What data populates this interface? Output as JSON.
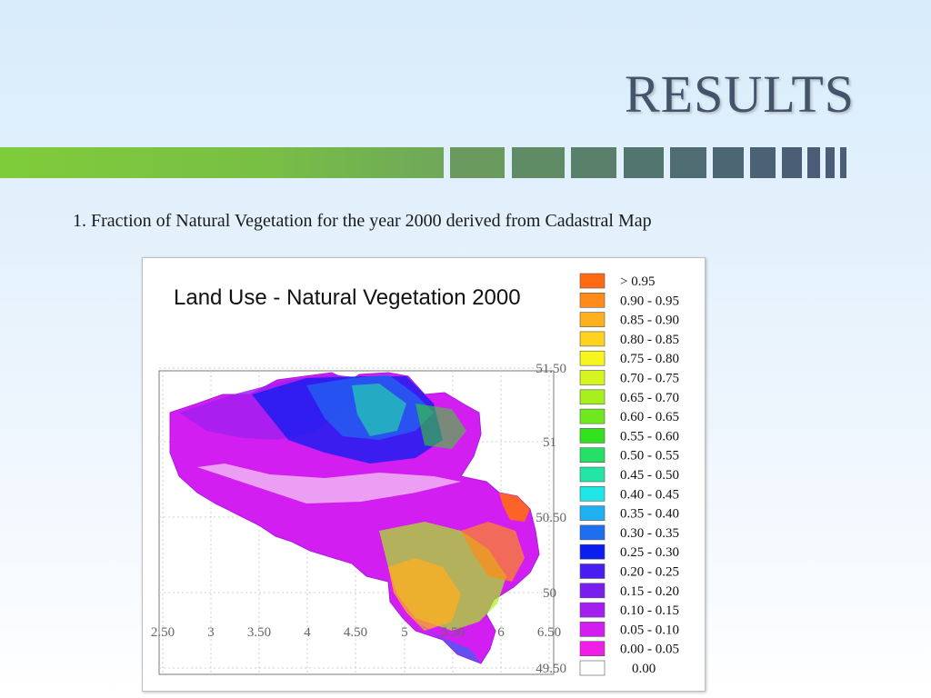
{
  "slide": {
    "title": "RESULTS",
    "caption": "1. Fraction of Natural Vegetation for the year 2000 derived from Cadastral Map"
  },
  "map": {
    "title": "Land Use - Natural Vegetation 2000",
    "x_ticks": [
      "2.50",
      "3",
      "3.50",
      "4",
      "4.50",
      "5",
      "5.50",
      "6",
      "6.50"
    ],
    "y_ticks": [
      "51.50",
      "51",
      "50.50",
      "50",
      "49.50"
    ],
    "legend": [
      {
        "label": "> 0.95",
        "color": "#ff6a13"
      },
      {
        "label": "0.90 - 0.95",
        "color": "#ff8c1a"
      },
      {
        "label": "0.85 - 0.90",
        "color": "#ffb01f"
      },
      {
        "label": "0.80 - 0.85",
        "color": "#ffd21f"
      },
      {
        "label": "0.75 - 0.80",
        "color": "#f6f51e"
      },
      {
        "label": "0.70 - 0.75",
        "color": "#d6f51e"
      },
      {
        "label": "0.65 - 0.70",
        "color": "#a7f01e"
      },
      {
        "label": "0.60 - 0.65",
        "color": "#6fe81e"
      },
      {
        "label": "0.55 - 0.60",
        "color": "#33e01e"
      },
      {
        "label": "0.50 - 0.55",
        "color": "#25e066"
      },
      {
        "label": "0.45 - 0.50",
        "color": "#23e6a6"
      },
      {
        "label": "0.40 - 0.45",
        "color": "#1ee6e6"
      },
      {
        "label": "0.35 - 0.40",
        "color": "#1eb0f0"
      },
      {
        "label": "0.30 - 0.35",
        "color": "#1e6ef0"
      },
      {
        "label": "0.25 - 0.30",
        "color": "#0a1ef0"
      },
      {
        "label": "0.20 - 0.25",
        "color": "#4a1ef0"
      },
      {
        "label": "0.15 - 0.20",
        "color": "#7a1ef0"
      },
      {
        "label": "0.10 - 0.15",
        "color": "#a51ef0"
      },
      {
        "label": "0.05 - 0.10",
        "color": "#d21ef0"
      },
      {
        "label": "0.00 - 0.05",
        "color": "#f01ee6"
      },
      {
        "label": "0.00",
        "color": "#ffffff"
      }
    ]
  },
  "colors": {
    "band_green": "#7cc242",
    "band_slate": "#4a5d73",
    "title_color": "#44546a"
  }
}
